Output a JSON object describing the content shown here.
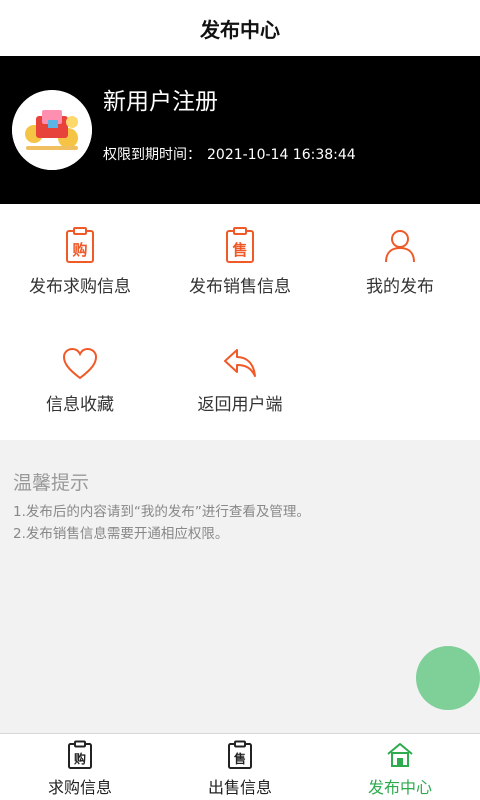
{
  "header": {
    "title": "发布中心"
  },
  "profile": {
    "name": "新用户注册",
    "expiry_label": "权限到期时间：",
    "expiry_value": "2021-10-14 16:38:44"
  },
  "actions": [
    {
      "label": "发布求购信息",
      "icon": "clipboard-buy-icon",
      "glyph": "购"
    },
    {
      "label": "发布销售信息",
      "icon": "clipboard-sell-icon",
      "glyph": "售"
    },
    {
      "label": "我的发布",
      "icon": "user-icon"
    },
    {
      "label": "信息收藏",
      "icon": "heart-icon"
    },
    {
      "label": "返回用户端",
      "icon": "return-arrow-icon"
    }
  ],
  "tips": {
    "title": "温馨提示",
    "lines": [
      "1.发布后的内容请到“我的发布”进行查看及管理。",
      "2.发布销售信息需要开通相应权限。"
    ]
  },
  "tabbar": {
    "active": 2,
    "tabs": [
      {
        "label": "求购信息",
        "icon": "clipboard-buy-icon",
        "glyph": "购"
      },
      {
        "label": "出售信息",
        "icon": "clipboard-sell-icon",
        "glyph": "售"
      },
      {
        "label": "发布中心",
        "icon": "home-icon"
      }
    ]
  },
  "colors": {
    "accent": "#f05a28",
    "active_tab": "#2eaa4f",
    "fab": "#7fcf98",
    "profile_bg": "#000000",
    "tips_bg": "#f2f2f2"
  }
}
